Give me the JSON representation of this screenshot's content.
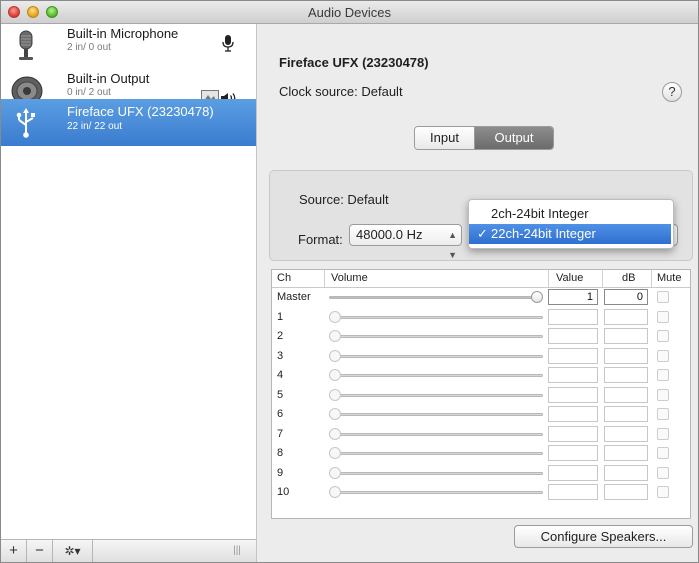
{
  "window": {
    "title": "Audio Devices"
  },
  "devices": [
    {
      "name": "Built-in Microphone",
      "io": "2 in/ 0 out",
      "icon": "microphone-icon"
    },
    {
      "name": "Built-in Output",
      "io": "0 in/ 2 out",
      "icon": "speaker-icon"
    },
    {
      "name": "Fireface UFX (23230478)",
      "io": "22 in/ 22 out",
      "icon": "usb-icon",
      "selected": true
    }
  ],
  "toolbar": {
    "add_label": "+",
    "remove_label": "−",
    "action_label": "✲▾",
    "resize_label": "|||"
  },
  "detail": {
    "device_title": "Fireface UFX (23230478)",
    "clock_source": "Clock source: Default",
    "help_label": "?",
    "tabs": [
      {
        "label": "Input",
        "selected": false
      },
      {
        "label": "Output",
        "selected": true
      }
    ],
    "source_text": "Source: Default",
    "format_label": "Format:",
    "sample_rate": "48000.0 Hz",
    "format_options": [
      {
        "label": "2ch-24bit Integer",
        "selected": false
      },
      {
        "label": "22ch-24bit Integer",
        "selected": true
      }
    ],
    "checkmark": "✓"
  },
  "table": {
    "headers": {
      "ch": "Ch",
      "volume": "Volume",
      "value": "Value",
      "db": "dB",
      "mute": "Mute"
    },
    "rows": [
      {
        "ch": "Master",
        "value": "1",
        "db": "0",
        "level": 1.0
      },
      {
        "ch": "1",
        "value": "",
        "db": "",
        "level": 0.0
      },
      {
        "ch": "2",
        "value": "",
        "db": "",
        "level": 0.0
      },
      {
        "ch": "3",
        "value": "",
        "db": "",
        "level": 0.0
      },
      {
        "ch": "4",
        "value": "",
        "db": "",
        "level": 0.0
      },
      {
        "ch": "5",
        "value": "",
        "db": "",
        "level": 0.0
      },
      {
        "ch": "6",
        "value": "",
        "db": "",
        "level": 0.0
      },
      {
        "ch": "7",
        "value": "",
        "db": "",
        "level": 0.0
      },
      {
        "ch": "8",
        "value": "",
        "db": "",
        "level": 0.0
      },
      {
        "ch": "9",
        "value": "",
        "db": "",
        "level": 0.0
      },
      {
        "ch": "10",
        "value": "",
        "db": "",
        "level": 0.0
      }
    ]
  },
  "configure_button": "Configure Speakers...",
  "colors": {
    "selection": "#3a7ccf",
    "menu_highlight": "#2e6fd0"
  }
}
